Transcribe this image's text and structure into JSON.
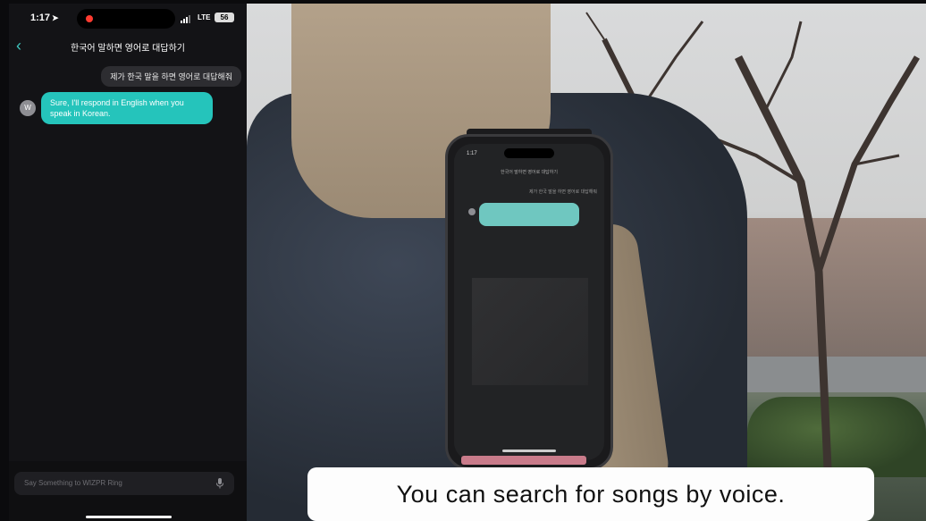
{
  "status_bar": {
    "time": "1:17",
    "network": "LTE",
    "battery": "56"
  },
  "chat": {
    "title": "한국어 말하면 영어로 대답하기",
    "user_message": "제가 한국 말을 하면 영어로 대답해줘",
    "bot_avatar": "W",
    "bot_message": "Sure, I'll respond in English when you speak in Korean."
  },
  "input": {
    "placeholder": "Say Something to WIZPR Ring"
  },
  "icons": {
    "back": "chevron-left-icon",
    "location": "location-arrow-icon",
    "mic": "microphone-icon",
    "signal": "cellular-signal-icon",
    "battery": "battery-icon"
  },
  "video": {
    "caption": "You can search for songs by voice."
  },
  "colors": {
    "accent": "#3ec8c0",
    "bot_bubble": "#25c4bb",
    "recording": "#ff3b30"
  }
}
